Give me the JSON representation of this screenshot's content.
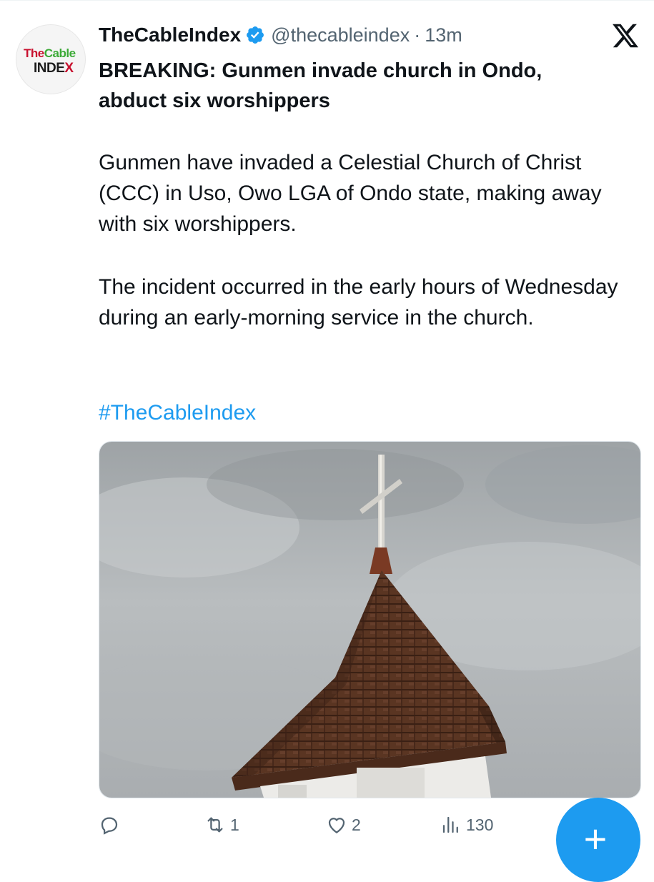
{
  "tweet": {
    "avatar": {
      "line1_the": "The",
      "line1_cable": "Cable",
      "line2": "INDE",
      "line2_x": "X"
    },
    "author_name": "TheCableIndex",
    "handle": "@thecableindex",
    "separator": "·",
    "time": "13m",
    "headline": "BREAKING: Gunmen invade church in Ondo, abduct six worshippers",
    "paragraph1": "Gunmen have invaded a Celestial Church of Christ (CCC) in Uso, Owo LGA of Ondo state, making away with six worshippers.",
    "paragraph2": "The incident occurred in the early hours of Wednesday during an early-morning service in the church.",
    "hashtag": "#TheCableIndex"
  },
  "actions": {
    "reply_count": "",
    "retweet_count": "1",
    "like_count": "2",
    "views_count": "130"
  },
  "icons": [
    "verified-icon",
    "x-logo-icon",
    "reply-icon",
    "retweet-icon",
    "like-icon",
    "views-icon",
    "share-icon",
    "compose-plus-icon"
  ],
  "colors": {
    "accent": "#1d9bf0",
    "secondary_text": "#536471",
    "brand_red": "#c8102e",
    "brand_green": "#3aa935"
  },
  "fab": {
    "label": "+"
  }
}
